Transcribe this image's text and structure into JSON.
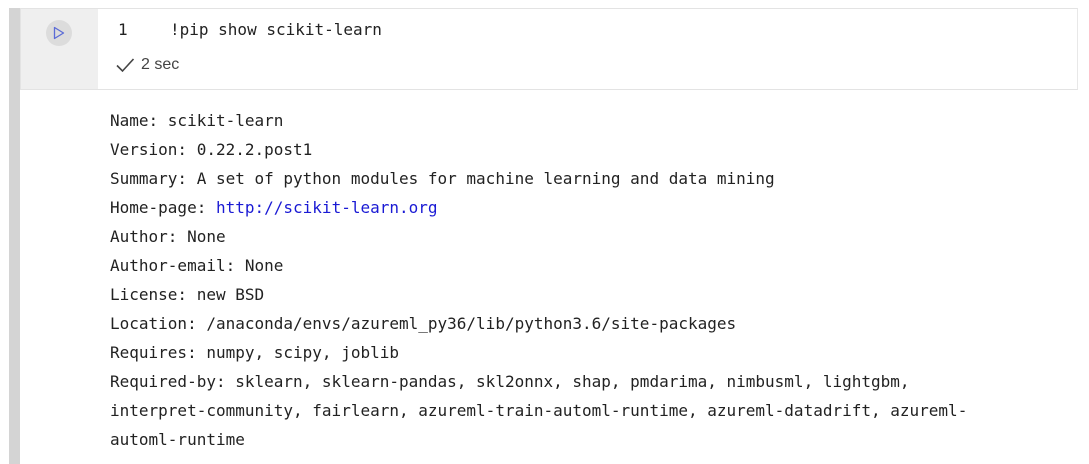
{
  "cell": {
    "line_number": "1",
    "code": "!pip show scikit-learn",
    "exec_time": "2 sec"
  },
  "output": {
    "name": "Name: scikit-learn",
    "version": "Version: 0.22.2.post1",
    "summary": "Summary: A set of python modules for machine learning and data mining",
    "homepage_label": "Home-page: ",
    "homepage_url": "http://scikit-learn.org",
    "author": "Author: None",
    "author_email": "Author-email: None",
    "license": "License: new BSD",
    "location": "Location: /anaconda/envs/azureml_py36/lib/python3.6/site-packages",
    "requires": "Requires: numpy, scipy, joblib",
    "required_by_1": "Required-by: sklearn, sklearn-pandas, skl2onnx, shap, pmdarima, nimbusml, lightgbm,",
    "required_by_2": "interpret-community, fairlearn, azureml-train-automl-runtime, azureml-datadrift, azureml-",
    "required_by_3": "automl-runtime"
  },
  "icons": {
    "run": "play-icon",
    "status": "check-icon"
  },
  "colors": {
    "link": "#1a1ad4",
    "run_icon": "#5b6bd6",
    "gutter": "#efefef",
    "left_bar": "#d4d4d4"
  }
}
